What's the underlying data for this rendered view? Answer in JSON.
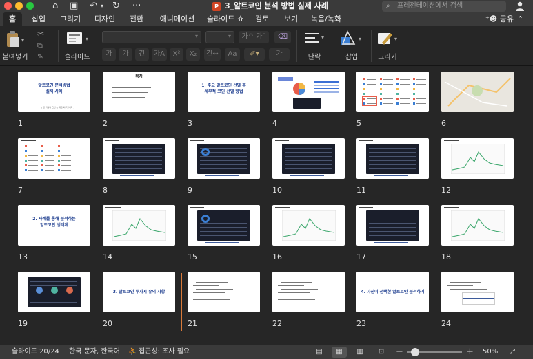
{
  "titlebar": {
    "doc_title": "3_알트코인 분석 방법 실제 사례",
    "search_placeholder": "프레젠테이션에서 검색",
    "ppt_badge": "P"
  },
  "tabs": [
    {
      "label": "홈",
      "active": true
    },
    {
      "label": "삽입"
    },
    {
      "label": "그리기"
    },
    {
      "label": "디자인"
    },
    {
      "label": "전환"
    },
    {
      "label": "애니메이션"
    },
    {
      "label": "슬라이드 쇼"
    },
    {
      "label": "검토"
    },
    {
      "label": "보기"
    },
    {
      "label": "녹음/녹화"
    }
  ],
  "share_label": "공유",
  "ribbon": {
    "paste_label": "붙여넣기",
    "slide_label": "슬라이드",
    "paragraph_label": "단락",
    "insert_label": "삽입",
    "draw_label": "그리기",
    "font_buttons": [
      "가",
      "가",
      "간",
      "가A",
      "X²",
      "X₂",
      "간↔",
      "가"
    ]
  },
  "slides": [
    {
      "num": "1",
      "kind": "title",
      "title": "알트코인 분석방법\n실제 사례",
      "sub": "[ 암 되살며 그런 손 대들 외주할니다 ]"
    },
    {
      "num": "2",
      "kind": "toc",
      "title": "목차"
    },
    {
      "num": "3",
      "kind": "title",
      "title": "1. 주요 알트코인 선별 후\n세부적 코인 선별 방법"
    },
    {
      "num": "4",
      "kind": "dash"
    },
    {
      "num": "5",
      "kind": "list"
    },
    {
      "num": "6",
      "kind": "map"
    },
    {
      "num": "7",
      "kind": "list2"
    },
    {
      "num": "8",
      "kind": "dark"
    },
    {
      "num": "9",
      "kind": "dark2"
    },
    {
      "num": "10",
      "kind": "dark"
    },
    {
      "num": "11",
      "kind": "dark"
    },
    {
      "num": "12",
      "kind": "chart"
    },
    {
      "num": "13",
      "kind": "title",
      "title": "2. 사례를 통해 분석하는\n알트코인 생태계"
    },
    {
      "num": "14",
      "kind": "chart"
    },
    {
      "num": "15",
      "kind": "dark2"
    },
    {
      "num": "16",
      "kind": "chart"
    },
    {
      "num": "17",
      "kind": "dark"
    },
    {
      "num": "18",
      "kind": "chart"
    },
    {
      "num": "19",
      "kind": "darkcircle"
    },
    {
      "num": "20",
      "kind": "title",
      "title": "3. 알트코인 투자시 유의 사항"
    },
    {
      "num": "21",
      "kind": "text"
    },
    {
      "num": "22",
      "kind": "text"
    },
    {
      "num": "23",
      "kind": "title",
      "title": "4. 자신이 선택한 알트코인 분석하기"
    },
    {
      "num": "24",
      "kind": "text2"
    }
  ],
  "statusbar": {
    "slide_count": "슬라이드 20/24",
    "language": "한국 문자, 한국어",
    "accessibility": "접근성: 조사 필요",
    "zoom": "50%",
    "zoom_fraction": 0.15
  }
}
